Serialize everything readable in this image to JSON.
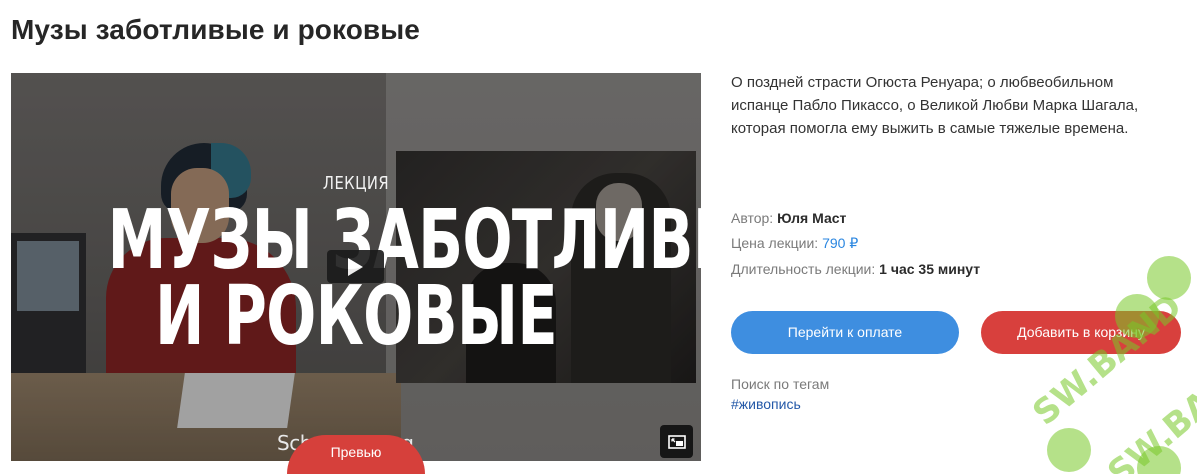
{
  "page": {
    "title": "Музы заботливые и роковые"
  },
  "video": {
    "lecture_label": "ЛЕКЦИЯ",
    "title_line1": "МУЗЫ ЗАБОТЛИВЫЕ",
    "title_line2": "И РОКОВЫЕ",
    "watermark_text": "Schoo  . . .  .org",
    "play_icon": "play-icon",
    "pip_icon": "picture-in-picture-icon",
    "preview_label": "Превью"
  },
  "details": {
    "description": "О поздней страсти Огюста Ренуара; о любвеобильном испанце Пабло Пикассо, о Великой Любви Марка Шагала, которая помогла ему выжить в самые тяжелые времена.",
    "author_label": "Автор:",
    "author_value": "Юля Маст",
    "price_label": "Цена лекции:",
    "price_value": "790 ₽",
    "duration_label": "Длительность лекции:",
    "duration_value": "1 час 35 минут"
  },
  "actions": {
    "pay_label": "Перейти к оплате",
    "cart_label": "Добавить в корзину"
  },
  "tags": {
    "label": "Поиск по тегам",
    "items": [
      "#живопись"
    ]
  },
  "colors": {
    "pay_button": "#3e8ee0",
    "cart_button": "#d8403d",
    "price": "#2a86e0",
    "tag": "#2358a8",
    "preview_badge": "#d6403b"
  }
}
